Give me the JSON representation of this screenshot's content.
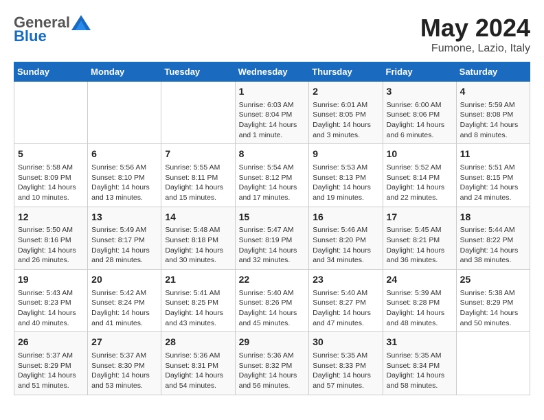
{
  "header": {
    "logo_general": "General",
    "logo_blue": "Blue",
    "month_year": "May 2024",
    "location": "Fumone, Lazio, Italy"
  },
  "days_of_week": [
    "Sunday",
    "Monday",
    "Tuesday",
    "Wednesday",
    "Thursday",
    "Friday",
    "Saturday"
  ],
  "weeks": [
    [
      {
        "day": "",
        "info": ""
      },
      {
        "day": "",
        "info": ""
      },
      {
        "day": "",
        "info": ""
      },
      {
        "day": "1",
        "info": "Sunrise: 6:03 AM\nSunset: 8:04 PM\nDaylight: 14 hours\nand 1 minute."
      },
      {
        "day": "2",
        "info": "Sunrise: 6:01 AM\nSunset: 8:05 PM\nDaylight: 14 hours\nand 3 minutes."
      },
      {
        "day": "3",
        "info": "Sunrise: 6:00 AM\nSunset: 8:06 PM\nDaylight: 14 hours\nand 6 minutes."
      },
      {
        "day": "4",
        "info": "Sunrise: 5:59 AM\nSunset: 8:08 PM\nDaylight: 14 hours\nand 8 minutes."
      }
    ],
    [
      {
        "day": "5",
        "info": "Sunrise: 5:58 AM\nSunset: 8:09 PM\nDaylight: 14 hours\nand 10 minutes."
      },
      {
        "day": "6",
        "info": "Sunrise: 5:56 AM\nSunset: 8:10 PM\nDaylight: 14 hours\nand 13 minutes."
      },
      {
        "day": "7",
        "info": "Sunrise: 5:55 AM\nSunset: 8:11 PM\nDaylight: 14 hours\nand 15 minutes."
      },
      {
        "day": "8",
        "info": "Sunrise: 5:54 AM\nSunset: 8:12 PM\nDaylight: 14 hours\nand 17 minutes."
      },
      {
        "day": "9",
        "info": "Sunrise: 5:53 AM\nSunset: 8:13 PM\nDaylight: 14 hours\nand 19 minutes."
      },
      {
        "day": "10",
        "info": "Sunrise: 5:52 AM\nSunset: 8:14 PM\nDaylight: 14 hours\nand 22 minutes."
      },
      {
        "day": "11",
        "info": "Sunrise: 5:51 AM\nSunset: 8:15 PM\nDaylight: 14 hours\nand 24 minutes."
      }
    ],
    [
      {
        "day": "12",
        "info": "Sunrise: 5:50 AM\nSunset: 8:16 PM\nDaylight: 14 hours\nand 26 minutes."
      },
      {
        "day": "13",
        "info": "Sunrise: 5:49 AM\nSunset: 8:17 PM\nDaylight: 14 hours\nand 28 minutes."
      },
      {
        "day": "14",
        "info": "Sunrise: 5:48 AM\nSunset: 8:18 PM\nDaylight: 14 hours\nand 30 minutes."
      },
      {
        "day": "15",
        "info": "Sunrise: 5:47 AM\nSunset: 8:19 PM\nDaylight: 14 hours\nand 32 minutes."
      },
      {
        "day": "16",
        "info": "Sunrise: 5:46 AM\nSunset: 8:20 PM\nDaylight: 14 hours\nand 34 minutes."
      },
      {
        "day": "17",
        "info": "Sunrise: 5:45 AM\nSunset: 8:21 PM\nDaylight: 14 hours\nand 36 minutes."
      },
      {
        "day": "18",
        "info": "Sunrise: 5:44 AM\nSunset: 8:22 PM\nDaylight: 14 hours\nand 38 minutes."
      }
    ],
    [
      {
        "day": "19",
        "info": "Sunrise: 5:43 AM\nSunset: 8:23 PM\nDaylight: 14 hours\nand 40 minutes."
      },
      {
        "day": "20",
        "info": "Sunrise: 5:42 AM\nSunset: 8:24 PM\nDaylight: 14 hours\nand 41 minutes."
      },
      {
        "day": "21",
        "info": "Sunrise: 5:41 AM\nSunset: 8:25 PM\nDaylight: 14 hours\nand 43 minutes."
      },
      {
        "day": "22",
        "info": "Sunrise: 5:40 AM\nSunset: 8:26 PM\nDaylight: 14 hours\nand 45 minutes."
      },
      {
        "day": "23",
        "info": "Sunrise: 5:40 AM\nSunset: 8:27 PM\nDaylight: 14 hours\nand 47 minutes."
      },
      {
        "day": "24",
        "info": "Sunrise: 5:39 AM\nSunset: 8:28 PM\nDaylight: 14 hours\nand 48 minutes."
      },
      {
        "day": "25",
        "info": "Sunrise: 5:38 AM\nSunset: 8:29 PM\nDaylight: 14 hours\nand 50 minutes."
      }
    ],
    [
      {
        "day": "26",
        "info": "Sunrise: 5:37 AM\nSunset: 8:29 PM\nDaylight: 14 hours\nand 51 minutes."
      },
      {
        "day": "27",
        "info": "Sunrise: 5:37 AM\nSunset: 8:30 PM\nDaylight: 14 hours\nand 53 minutes."
      },
      {
        "day": "28",
        "info": "Sunrise: 5:36 AM\nSunset: 8:31 PM\nDaylight: 14 hours\nand 54 minutes."
      },
      {
        "day": "29",
        "info": "Sunrise: 5:36 AM\nSunset: 8:32 PM\nDaylight: 14 hours\nand 56 minutes."
      },
      {
        "day": "30",
        "info": "Sunrise: 5:35 AM\nSunset: 8:33 PM\nDaylight: 14 hours\nand 57 minutes."
      },
      {
        "day": "31",
        "info": "Sunrise: 5:35 AM\nSunset: 8:34 PM\nDaylight: 14 hours\nand 58 minutes."
      },
      {
        "day": "",
        "info": ""
      }
    ]
  ]
}
